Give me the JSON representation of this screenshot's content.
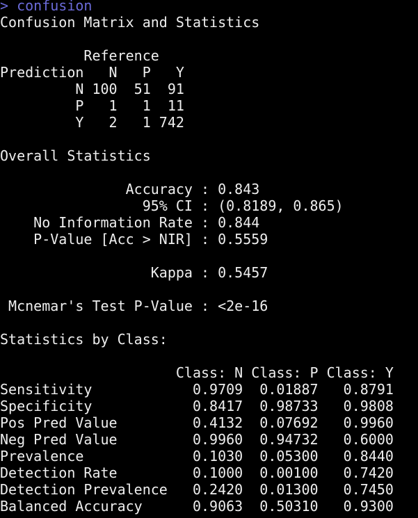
{
  "console": {
    "prompt_symbol": ">",
    "command": "confusion",
    "colors": {
      "background": "#000000",
      "text": "#eeeeee",
      "prompt": "#6b6bd9"
    },
    "output_lines": [
      "Confusion Matrix and Statistics",
      "",
      "          Reference",
      "Prediction   N   P   Y",
      "         N 100  51  91",
      "         P   1   1  11",
      "         Y   2   1 742",
      "",
      "Overall Statistics",
      "",
      "               Accuracy : 0.843",
      "                 95% CI : (0.8189, 0.865)",
      "    No Information Rate : 0.844",
      "    P-Value [Acc > NIR] : 0.5559",
      "",
      "                  Kappa : 0.5457",
      "",
      " Mcnemar's Test P-Value : <2e-16",
      "",
      "Statistics by Class:",
      "",
      "                     Class: N Class: P Class: Y",
      "Sensitivity            0.9709  0.01887   0.8791",
      "Specificity            0.8417  0.98733   0.9808",
      "Pos Pred Value         0.4132  0.07692   0.9960",
      "Neg Pred Value         0.9960  0.94732   0.6000",
      "Prevalence             0.1030  0.05300   0.8440",
      "Detection Rate         0.1000  0.00100   0.7420",
      "Detection Prevalence   0.2420  0.01300   0.7450",
      "Balanced Accuracy      0.9063  0.50310   0.9300"
    ]
  }
}
